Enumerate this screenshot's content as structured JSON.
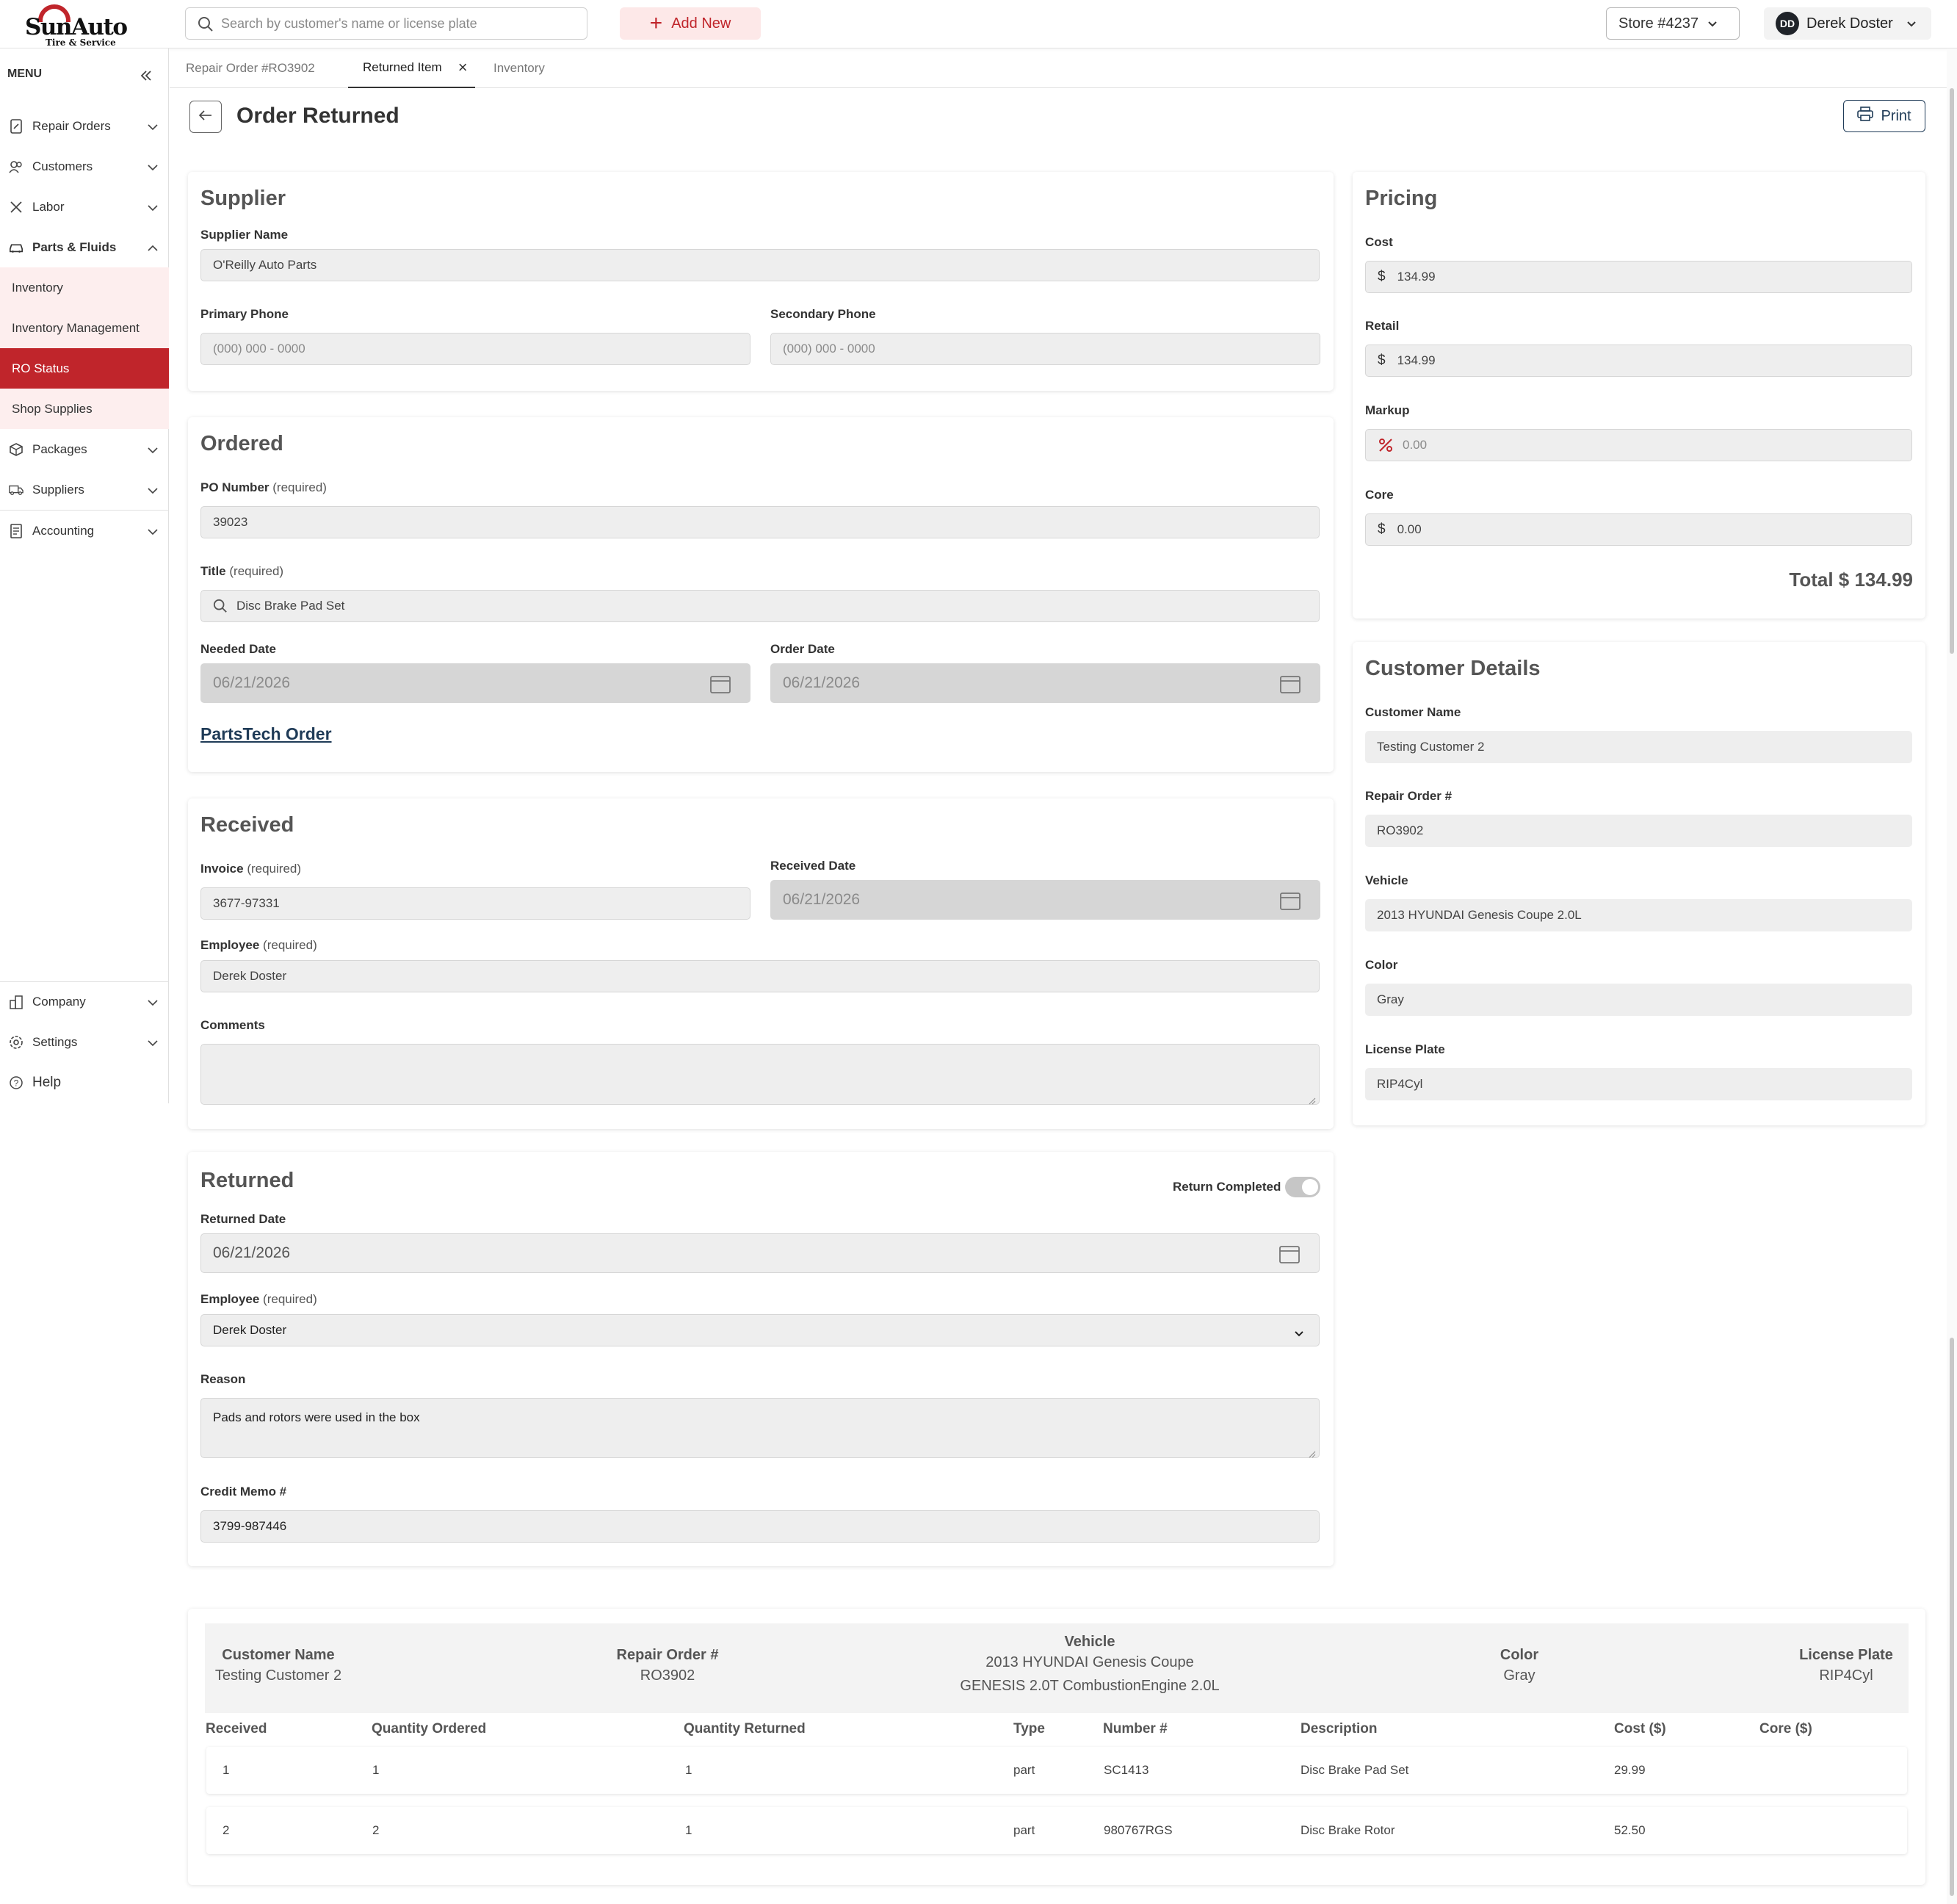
{
  "brand": {
    "name": "SunAuto",
    "tagline": "Tire & Service"
  },
  "topbar": {
    "search_placeholder": "Search by customer's name or license plate",
    "add_new": "Add New",
    "store": "Store #4237",
    "user_initials": "DD",
    "user_name": "Derek Doster"
  },
  "sidebar": {
    "menu_label": "MENU",
    "items": {
      "repair_orders": "Repair Orders",
      "customers": "Customers",
      "labor": "Labor",
      "parts_fluids": "Parts & Fluids",
      "inventory": "Inventory",
      "inventory_management": "Inventory Management",
      "ro_status": "RO Status",
      "shop_supplies": "Shop Supplies",
      "packages": "Packages",
      "suppliers": "Suppliers",
      "accounting": "Accounting",
      "company": "Company",
      "settings": "Settings",
      "help": "Help"
    }
  },
  "tabs": {
    "t1": "Repair Order #RO3902",
    "t2": "Returned Item",
    "t3": "Inventory"
  },
  "page": {
    "title": "Order Returned",
    "print": "Print"
  },
  "supplier": {
    "title": "Supplier",
    "name_label": "Supplier Name",
    "name_value": "O'Reilly Auto Parts",
    "primary_label": "Primary Phone",
    "primary_placeholder": "(000) 000 - 0000",
    "secondary_label": "Secondary Phone",
    "secondary_placeholder": "(000) 000 - 0000"
  },
  "ordered": {
    "title": "Ordered",
    "po_label": "PO Number",
    "required": "(required)",
    "po_value": "39023",
    "title_label": "Title",
    "title_value": "Disc Brake Pad Set",
    "needed_label": "Needed Date",
    "needed_value": "06/21/2026",
    "order_label": "Order Date",
    "order_value": "06/21/2026",
    "partstech": "PartsTech Order"
  },
  "received": {
    "title": "Received",
    "invoice_label": "Invoice",
    "invoice_value": "3677-97331",
    "date_label": "Received Date",
    "date_value": "06/21/2026",
    "employee_label": "Employee",
    "employee_value": "Derek Doster",
    "comments_label": "Comments",
    "comments_value": ""
  },
  "returned": {
    "title": "Returned",
    "toggle_label": "Return Completed",
    "toggle_on": true,
    "date_label": "Returned Date",
    "date_value": "06/21/2026",
    "employee_label": "Employee",
    "employee_value": "Derek Doster",
    "reason_label": "Reason",
    "reason_value": "Pads and rotors were used in the box",
    "memo_label": "Credit Memo #",
    "memo_value": "3799-987446"
  },
  "pricing": {
    "title": "Pricing",
    "cost_label": "Cost",
    "cost_value": "134.99",
    "retail_label": "Retail",
    "retail_value": "134.99",
    "markup_label": "Markup",
    "markup_placeholder": "0.00",
    "core_label": "Core",
    "core_value": "0.00",
    "currency": "$",
    "total": "Total $ 134.99"
  },
  "customer": {
    "title": "Customer Details",
    "name_label": "Customer Name",
    "name_value": "Testing Customer 2",
    "ro_label": "Repair Order #",
    "ro_value": "RO3902",
    "vehicle_label": "Vehicle",
    "vehicle_value": "2013 HYUNDAI Genesis Coupe 2.0L",
    "color_label": "Color",
    "color_value": "Gray",
    "plate_label": "License Plate",
    "plate_value": "RIP4Cyl"
  },
  "summary": {
    "customer_name_h": "Customer Name",
    "customer_name_v": "Testing Customer 2",
    "ro_h": "Repair Order #",
    "ro_v": "RO3902",
    "vehicle_h": "Vehicle",
    "vehicle_v1": "2013 HYUNDAI Genesis Coupe",
    "vehicle_v2": "GENESIS 2.0T CombustionEngine 2.0L",
    "color_h": "Color",
    "color_v": "Gray",
    "plate_h": "License Plate",
    "plate_v": "RIP4Cyl"
  },
  "table": {
    "headers": [
      "Received",
      "Quantity Ordered",
      "Quantity Returned",
      "Type",
      "Number #",
      "Description",
      "Cost ($)",
      "Core ($)"
    ],
    "rows": [
      [
        "1",
        "1",
        "1",
        "part",
        "SC1413",
        "Disc Brake Pad Set",
        "29.99",
        ""
      ],
      [
        "2",
        "2",
        "1",
        "part",
        "980767RGS",
        "Disc Brake Rotor",
        "52.50",
        ""
      ]
    ]
  },
  "colors": {
    "brand_red": "#c0252b",
    "navy": "#1f3b57",
    "field_bg": "#eeeeee"
  }
}
